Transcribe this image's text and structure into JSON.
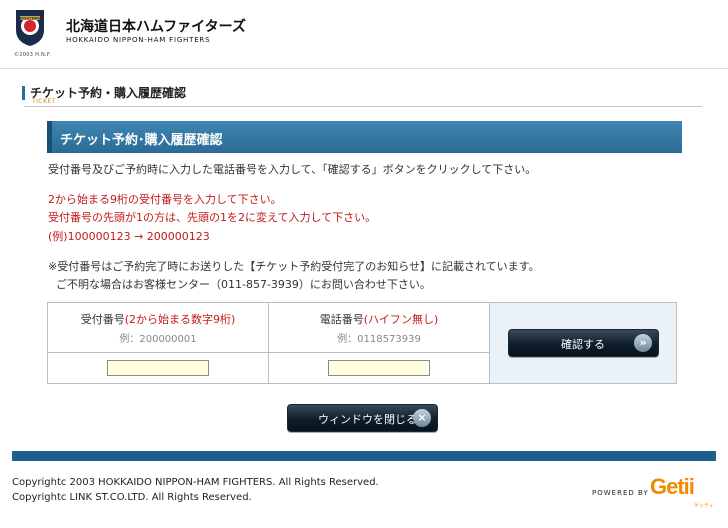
{
  "header": {
    "brand_jp": "北海道日本ハムファイターズ",
    "brand_en": "HOKKAIDO NIPPON-HAM FIGHTERS",
    "logo_text": "FIGHTERS",
    "logo_copyright": "©2003 H.N.F."
  },
  "page": {
    "title": "チケット予約・購入履歴確認",
    "subtitle": "TICKET"
  },
  "section": {
    "title": "チケット予約･購入履歴確認"
  },
  "instructions": {
    "line1": "受付番号及びご予約時に入力した電話番号を入力して、「確認する」ボタンをクリックして下さい。",
    "red1": "2から始まる9桁の受付番号を入力して下さい。",
    "red2": "受付番号の先頭が1の方は、先頭の1を2に変えて入力して下さい。",
    "red3": "(例)100000123 → 200000123",
    "note1": "※受付番号はご予約完了時にお送りした【チケット予約受付完了のお知らせ】に記載されています。",
    "note2": "ご不明な場合はお客様センター（011-857-3939）にお問い合わせ下さい。"
  },
  "form": {
    "receipt": {
      "label": "受付番号",
      "label_note": "(2から始まる数字9桁)",
      "example": "例：200000001",
      "value": "",
      "placeholder": ""
    },
    "phone": {
      "label": "電話番号",
      "label_note": "(ハイフン無し)",
      "example": "例：0118573939",
      "value": "",
      "placeholder": ""
    },
    "confirm_label": "確認する",
    "confirm_icon": "»"
  },
  "close": {
    "label": "ウィンドウを閉じる",
    "icon": "×"
  },
  "footer": {
    "copy1": "Copyrightc 2003 HOKKAIDO NIPPON-HAM FIGHTERS. All Rights Reserved.",
    "copy2": "Copyrightc LINK ST.CO.LTD. All Rights Reserved.",
    "powered_by": "POWERED BY",
    "getii": "Getii",
    "getii_jp": "ゲッティ"
  },
  "colors": {
    "banner": "#2b6b95",
    "red_text": "#c31a1a",
    "footer_bar": "#1d5f8c",
    "getii_orange": "#f08a00"
  }
}
